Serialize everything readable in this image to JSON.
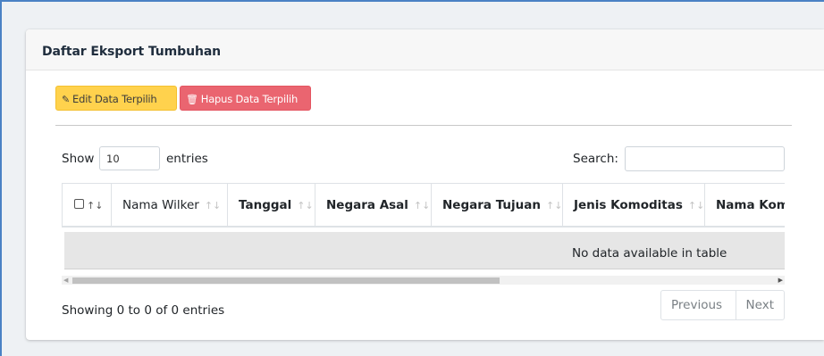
{
  "card": {
    "title": "Daftar Eksport Tumbuhan"
  },
  "toolbar": {
    "edit_label": "Edit Data Terpilih",
    "edit_icon": "edit-icon",
    "delete_label": "Hapus Data Terpilih",
    "delete_icon": "trash-icon",
    "edit_color": "#ffd24d",
    "delete_color": "#ea6570"
  },
  "length": {
    "show": "Show",
    "value": "10",
    "entries": "entries"
  },
  "search": {
    "label": "Search:",
    "value": ""
  },
  "table": {
    "columns": [
      "Nama Wilker",
      "Tanggal",
      "Negara Asal",
      "Negara Tujuan",
      "Jenis Komoditas",
      "Nama Kom"
    ],
    "empty": "No data available in table"
  },
  "footer": {
    "info": "Showing 0 to 0 of 0 entries",
    "previous": "Previous",
    "next": "Next"
  }
}
